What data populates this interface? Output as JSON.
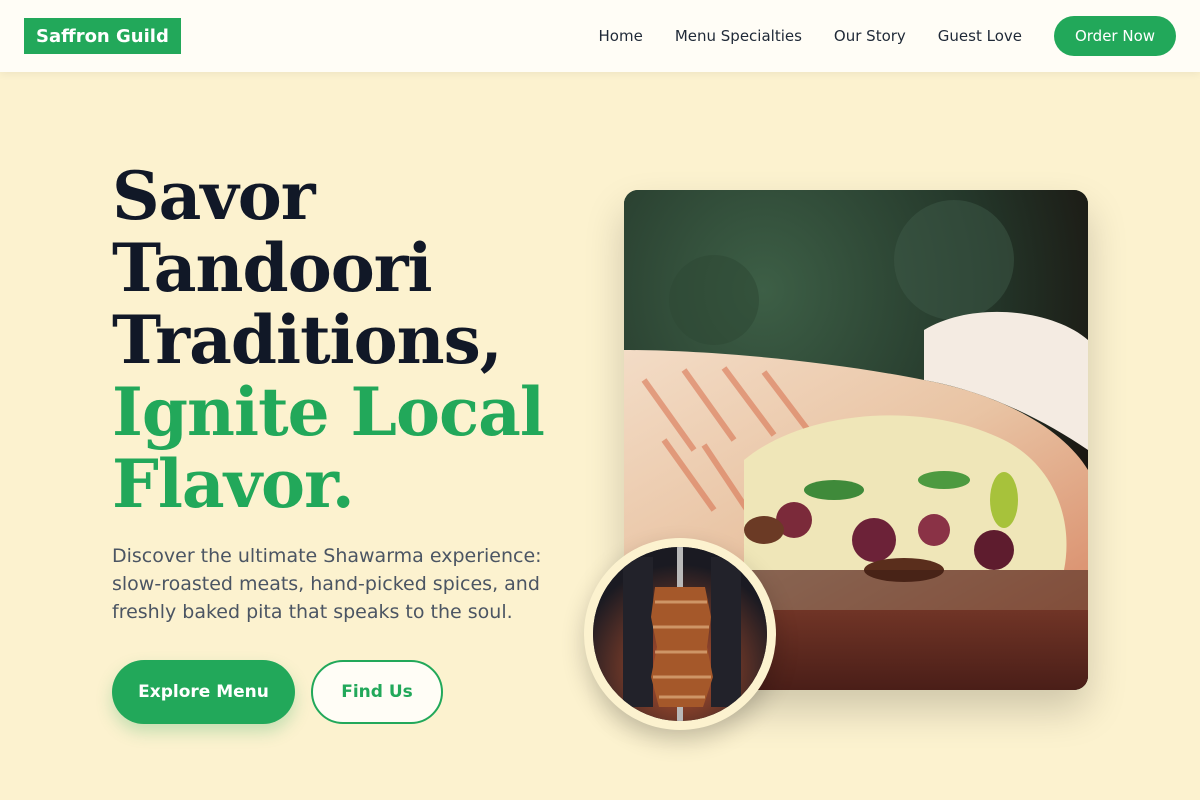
{
  "brand": {
    "name": "Saffron Guild"
  },
  "nav": {
    "items": [
      "Home",
      "Menu Specialties",
      "Our Story",
      "Guest Love"
    ],
    "cta": "Order Now"
  },
  "hero": {
    "title_lines": [
      "Savor",
      "Tandoori",
      "Traditions,"
    ],
    "accent_lines": [
      "Ignite Local",
      "Flavor."
    ],
    "subtitle": "Discover the ultimate Shawarma experience: slow-roasted meats, hand-picked spices, and freshly baked pita that speaks to the soul.",
    "primary_button": "Explore Menu",
    "secondary_button": "Find Us",
    "image_alt": "Shawarma wrap close-up",
    "inset_alt": "Shawarma spit"
  },
  "colors": {
    "accent": "#22a85a",
    "background": "#fcf2cf",
    "header_bg": "#fffdf6",
    "heading": "#111827",
    "body_text": "#4b5563"
  },
  "icons": [
    "shawarma-photo",
    "spit-photo"
  ]
}
